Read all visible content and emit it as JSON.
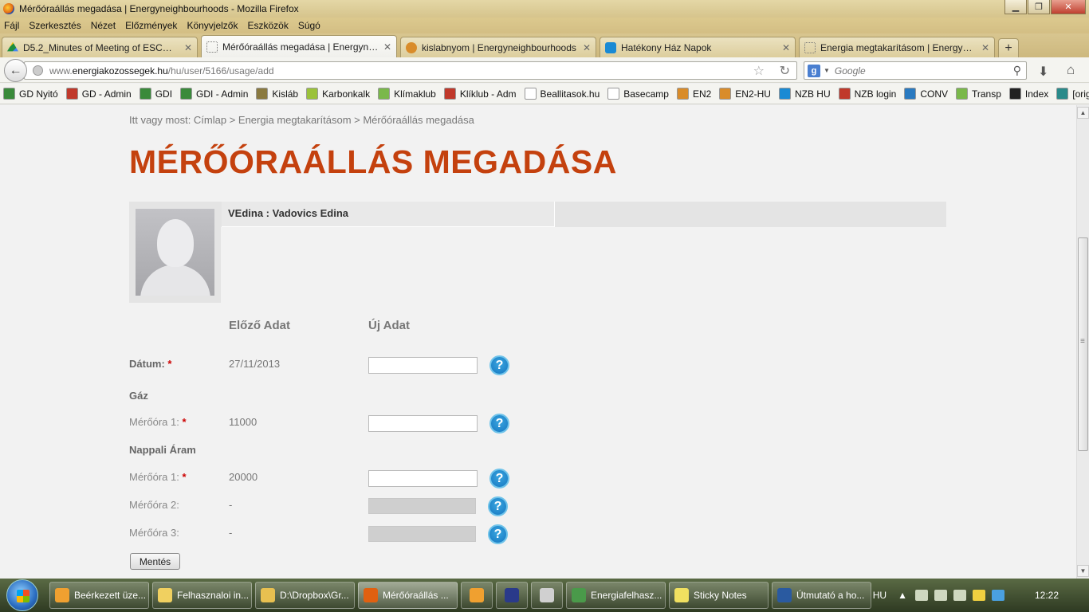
{
  "window": {
    "title": "Mérőóraállás megadása | Energyneighbourhoods - Mozilla Firefox",
    "min": "▁",
    "max": "❐",
    "close": "✕"
  },
  "menu": [
    "Fájl",
    "Szerkesztés",
    "Nézet",
    "Előzmények",
    "Könyvjelzők",
    "Eszközök",
    "Súgó"
  ],
  "tabs": [
    {
      "label": "D5.2_Minutes of Meeting of ESCO an...",
      "icon": "drive"
    },
    {
      "label": "Mérőóraállás megadása | Energyneig...",
      "icon": "blank",
      "active": true
    },
    {
      "label": "kislabnyom | Energyneighbourhoods",
      "icon": "tiger"
    },
    {
      "label": "Hatékony Ház Napok",
      "icon": "blue"
    },
    {
      "label": "Energia megtakarításom | Energyneig...",
      "icon": "blank"
    }
  ],
  "nav": {
    "url_prefix": "www.",
    "url_domain": "energiakozossegek.hu",
    "url_path": "/hu/user/5166/usage/add",
    "search_placeholder": "Google"
  },
  "bookmarks": [
    {
      "label": "GD Nyitó",
      "color": "#3a8a3a"
    },
    {
      "label": "GD - Admin",
      "color": "#c0392b"
    },
    {
      "label": "GDI",
      "color": "#3a8a3a"
    },
    {
      "label": "GDI - Admin",
      "color": "#3a8a3a"
    },
    {
      "label": "Kisláb",
      "color": "#8a7a40"
    },
    {
      "label": "Karbonkalk",
      "color": "#9bc23a"
    },
    {
      "label": "Klímaklub",
      "color": "#7ab84a"
    },
    {
      "label": "Klíklub - Adm",
      "color": "#c0392b"
    },
    {
      "label": "Beallitasok.hu",
      "color": "#ffffff"
    },
    {
      "label": "Basecamp",
      "color": "#ffffff"
    },
    {
      "label": "EN2",
      "color": "#d98c2a"
    },
    {
      "label": "EN2-HU",
      "color": "#d98c2a"
    },
    {
      "label": "NZB HU",
      "color": "#1a8ad4"
    },
    {
      "label": "NZB login",
      "color": "#c0392b"
    },
    {
      "label": "CONV",
      "color": "#2a7ac0"
    },
    {
      "label": "Transp",
      "color": "#7ab84a"
    },
    {
      "label": "Index",
      "color": "#222222"
    },
    {
      "label": "[origo]",
      "color": "#2a8a8a"
    }
  ],
  "page": {
    "breadcrumb": "Itt vagy most: Címlap > Energia megtakarításom > Mérőóraállás megadása",
    "title": "MÉRŐÓRAÁLLÁS MEGADÁSA",
    "user": "VEdina : Vadovics Edina",
    "col_prev": "Előző Adat",
    "col_new": "Új Adat",
    "date_label": "Dátum:",
    "date_prev": "27/11/2013",
    "gas_heading": "Gáz",
    "gas_meter_label": "Mérőóra 1:",
    "gas_meter_prev": "11000",
    "power_heading": "Nappali Áram",
    "power_meter1_label": "Mérőóra 1:",
    "power_meter1_prev": "20000",
    "power_meter2_label": "Mérőóra 2:",
    "power_meter2_prev": "-",
    "power_meter3_label": "Mérőóra 3:",
    "power_meter3_prev": "-",
    "required": "*",
    "help": "?",
    "save": "Mentés"
  },
  "taskbar": {
    "items": [
      {
        "label": "Beérkezett üze...",
        "color": "#f0a030"
      },
      {
        "label": "Felhasznaloi in...",
        "color": "#f0d060"
      },
      {
        "label": "D:\\Dropbox\\Gr...",
        "color": "#e8c050"
      },
      {
        "label": "Mérőóraállás ...",
        "color": "#e06010",
        "active": true
      }
    ],
    "items2": [
      {
        "label": "Energiafelhasz...",
        "color": "#4a9a4a"
      },
      {
        "label": "Sticky Notes",
        "color": "#f0e060"
      },
      {
        "label": "Útmutató a ho...",
        "color": "#2a5aa0"
      }
    ],
    "lang": "HU",
    "time": "12:22"
  }
}
